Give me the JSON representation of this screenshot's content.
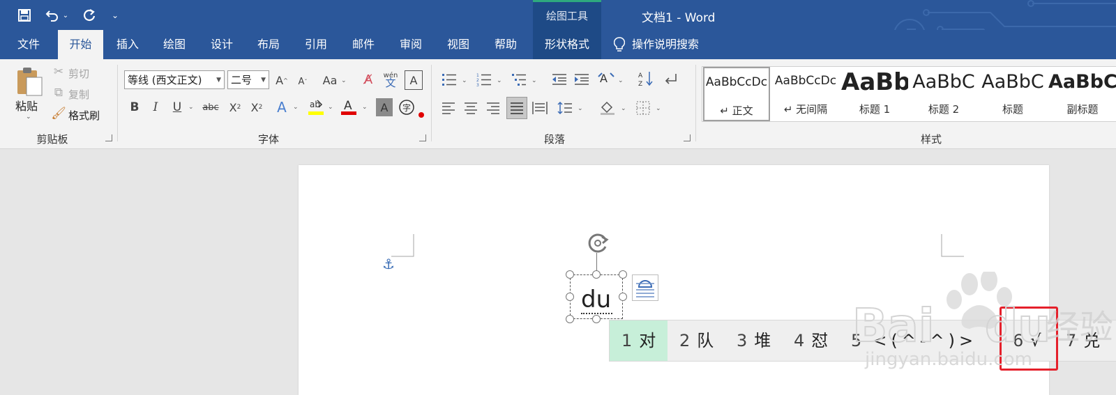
{
  "window": {
    "title": "文档1  -  Word",
    "tool_group_title": "绘图工具"
  },
  "qat": {
    "save_icon": "save-icon",
    "undo_icon": "undo-icon",
    "redo_icon": "redo-icon",
    "customize_icon": "customize-qat-icon"
  },
  "tabs": {
    "file": "文件",
    "home": "开始",
    "insert": "插入",
    "draw": "绘图",
    "design": "设计",
    "layout": "布局",
    "references": "引用",
    "mailings": "邮件",
    "review": "审阅",
    "view": "视图",
    "help": "帮助",
    "shape_format": "形状格式",
    "tell_me": "操作说明搜索"
  },
  "clipboard": {
    "paste": "粘贴",
    "cut": "剪切",
    "copy": "复制",
    "format_painter": "格式刷",
    "label": "剪贴板"
  },
  "font": {
    "name": "等线 (西文正文)",
    "size": "二号",
    "label": "字体",
    "case": "Aa",
    "phonetic": "wén",
    "phonetic_char": "文"
  },
  "paragraph": {
    "label": "段落"
  },
  "styles": {
    "label": "样式",
    "items": [
      {
        "sample": "AaBbCcDc",
        "name": "↵ 正文"
      },
      {
        "sample": "AaBbCcDc",
        "name": "↵ 无间隔"
      },
      {
        "sample": "AaBb",
        "name": "标题 1"
      },
      {
        "sample": "AaBbC",
        "name": "标题 2"
      },
      {
        "sample": "AaBbC",
        "name": "标题"
      },
      {
        "sample": "AaBbC",
        "name": "副标题"
      }
    ]
  },
  "document": {
    "shape_text": "du"
  },
  "ime": {
    "candidates": [
      {
        "num": "1",
        "text": "对"
      },
      {
        "num": "2",
        "text": "队"
      },
      {
        "num": "3",
        "text": "堆"
      },
      {
        "num": "4",
        "text": "怼"
      },
      {
        "num": "5",
        "text": "<(^-^)>"
      },
      {
        "num": "6",
        "text": "√"
      },
      {
        "num": "7",
        "text": "兑"
      }
    ]
  },
  "watermark": {
    "text": "Bai du 经验",
    "url": "jingyan.baidu.com"
  },
  "colors": {
    "brand": "#2b579a",
    "highlight_yellow": "#ffff00",
    "font_red": "#e00000",
    "candidate_highlight": "#c7efd9",
    "annotation_red": "#e5202b"
  }
}
